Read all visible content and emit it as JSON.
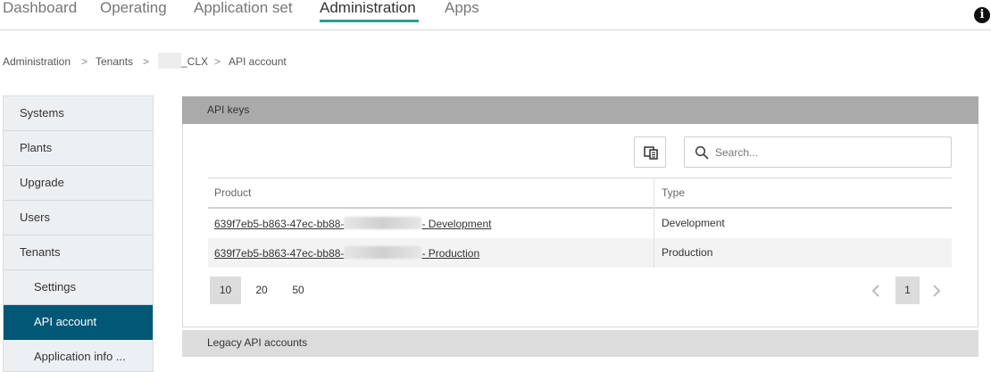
{
  "nav": {
    "items": [
      "Dashboard",
      "Operating",
      "Application set",
      "Administration",
      "Apps"
    ],
    "active_index": 3
  },
  "breadcrumb": {
    "items": [
      "Administration",
      "Tenants",
      "_CLX",
      "API account"
    ],
    "separator": ">"
  },
  "sidebar": {
    "items": [
      "Systems",
      "Plants",
      "Upgrade",
      "Users",
      "Tenants",
      "Settings",
      "API account",
      "Application info ..."
    ],
    "active_index": 6,
    "accent_color": "#005776"
  },
  "api_keys": {
    "title": "API keys",
    "search_placeholder": "Search...",
    "columns": [
      "Product",
      "Type"
    ],
    "rows": [
      {
        "product_prefix": "639f7eb5-b863-47ec-bb88-",
        "product_suffix": "- Development",
        "type": "Development"
      },
      {
        "product_prefix": "639f7eb5-b863-47ec-bb88-",
        "product_suffix": "- Production",
        "type": "Production"
      }
    ],
    "page_sizes": [
      "10",
      "20",
      "50"
    ],
    "active_page_size": "10",
    "current_page": "1"
  },
  "legacy": {
    "title": "Legacy API accounts"
  },
  "info_icon_glyph": "i"
}
